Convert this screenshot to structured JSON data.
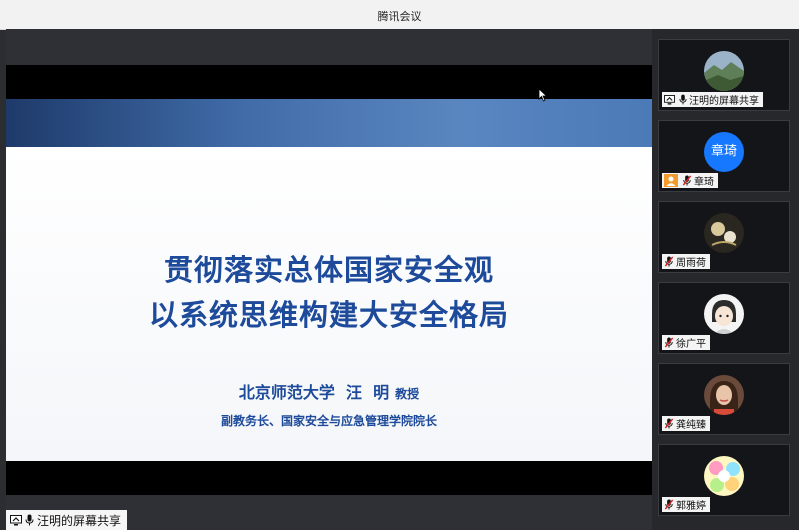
{
  "app": {
    "title": "腾讯会议"
  },
  "slide": {
    "title_line1": "贯彻落实总体国家安全观",
    "title_line2": "以系统思维构建大安全格局",
    "presenter_name": "北京师范大学  汪  明",
    "presenter_title": "教授",
    "affiliation": "副教务长、国家安全与应急管理学院院长"
  },
  "share_label": "汪明的屏幕共享",
  "participants": [
    {
      "name": "汪明的屏幕共享",
      "avatar": "landscape-photo",
      "icon": "screen-share-icon"
    },
    {
      "name": "章琦",
      "avatar_text": "章琦",
      "avatar_color": "#1677ff",
      "icon": "person-icon"
    },
    {
      "name": "周雨荷",
      "avatar": "dark-illustration"
    },
    {
      "name": "徐广平",
      "avatar": "cartoon-portrait"
    },
    {
      "name": "龚纯臻",
      "avatar": "woman-portrait"
    },
    {
      "name": "郭雅婷",
      "avatar": "colorful-sticker"
    }
  ],
  "colors": {
    "accent_blue": "#1d4a9a",
    "avatar_blue": "#1677ff",
    "mic_muted_red": "#e02020"
  }
}
